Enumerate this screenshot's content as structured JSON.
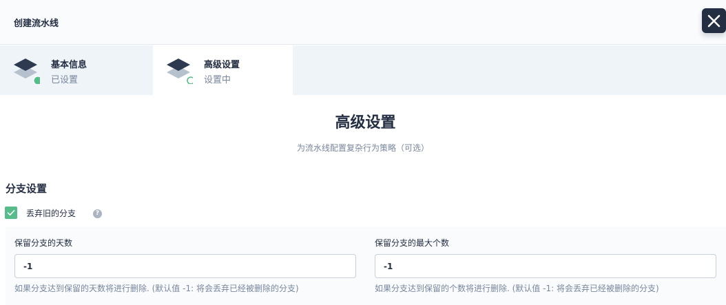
{
  "header": {
    "title": "创建流水线"
  },
  "steps": [
    {
      "name": "基本信息",
      "status": "已设置"
    },
    {
      "name": "高级设置",
      "status": "设置中"
    }
  ],
  "main": {
    "title": "高级设置",
    "subtitle": "为流水线配置复杂行为策略（可选）"
  },
  "branch": {
    "section_title": "分支设置",
    "discard_label": "丢弃旧的分支",
    "discard_checked": true,
    "help_glyph": "?",
    "days": {
      "label": "保留分支的天数",
      "value": "-1",
      "description": "如果分支达到保留的天数将进行删除. (默认值 -1: 将会丢弃已经被删除的分支)"
    },
    "max": {
      "label": "保留分支的最大个数",
      "value": "-1",
      "description": "如果分支达到保留的个数将进行删除. (默认值 -1: 将会丢弃已经被删除的分支)"
    }
  },
  "colors": {
    "primary_dark": "#242e42",
    "success_green": "#55bc8a",
    "muted_text": "#79879c",
    "step_bar_bg": "#eff4f9"
  },
  "icons": {
    "close": "close-icon",
    "step": "layers-icon",
    "check": "check-icon",
    "help": "help-icon"
  }
}
